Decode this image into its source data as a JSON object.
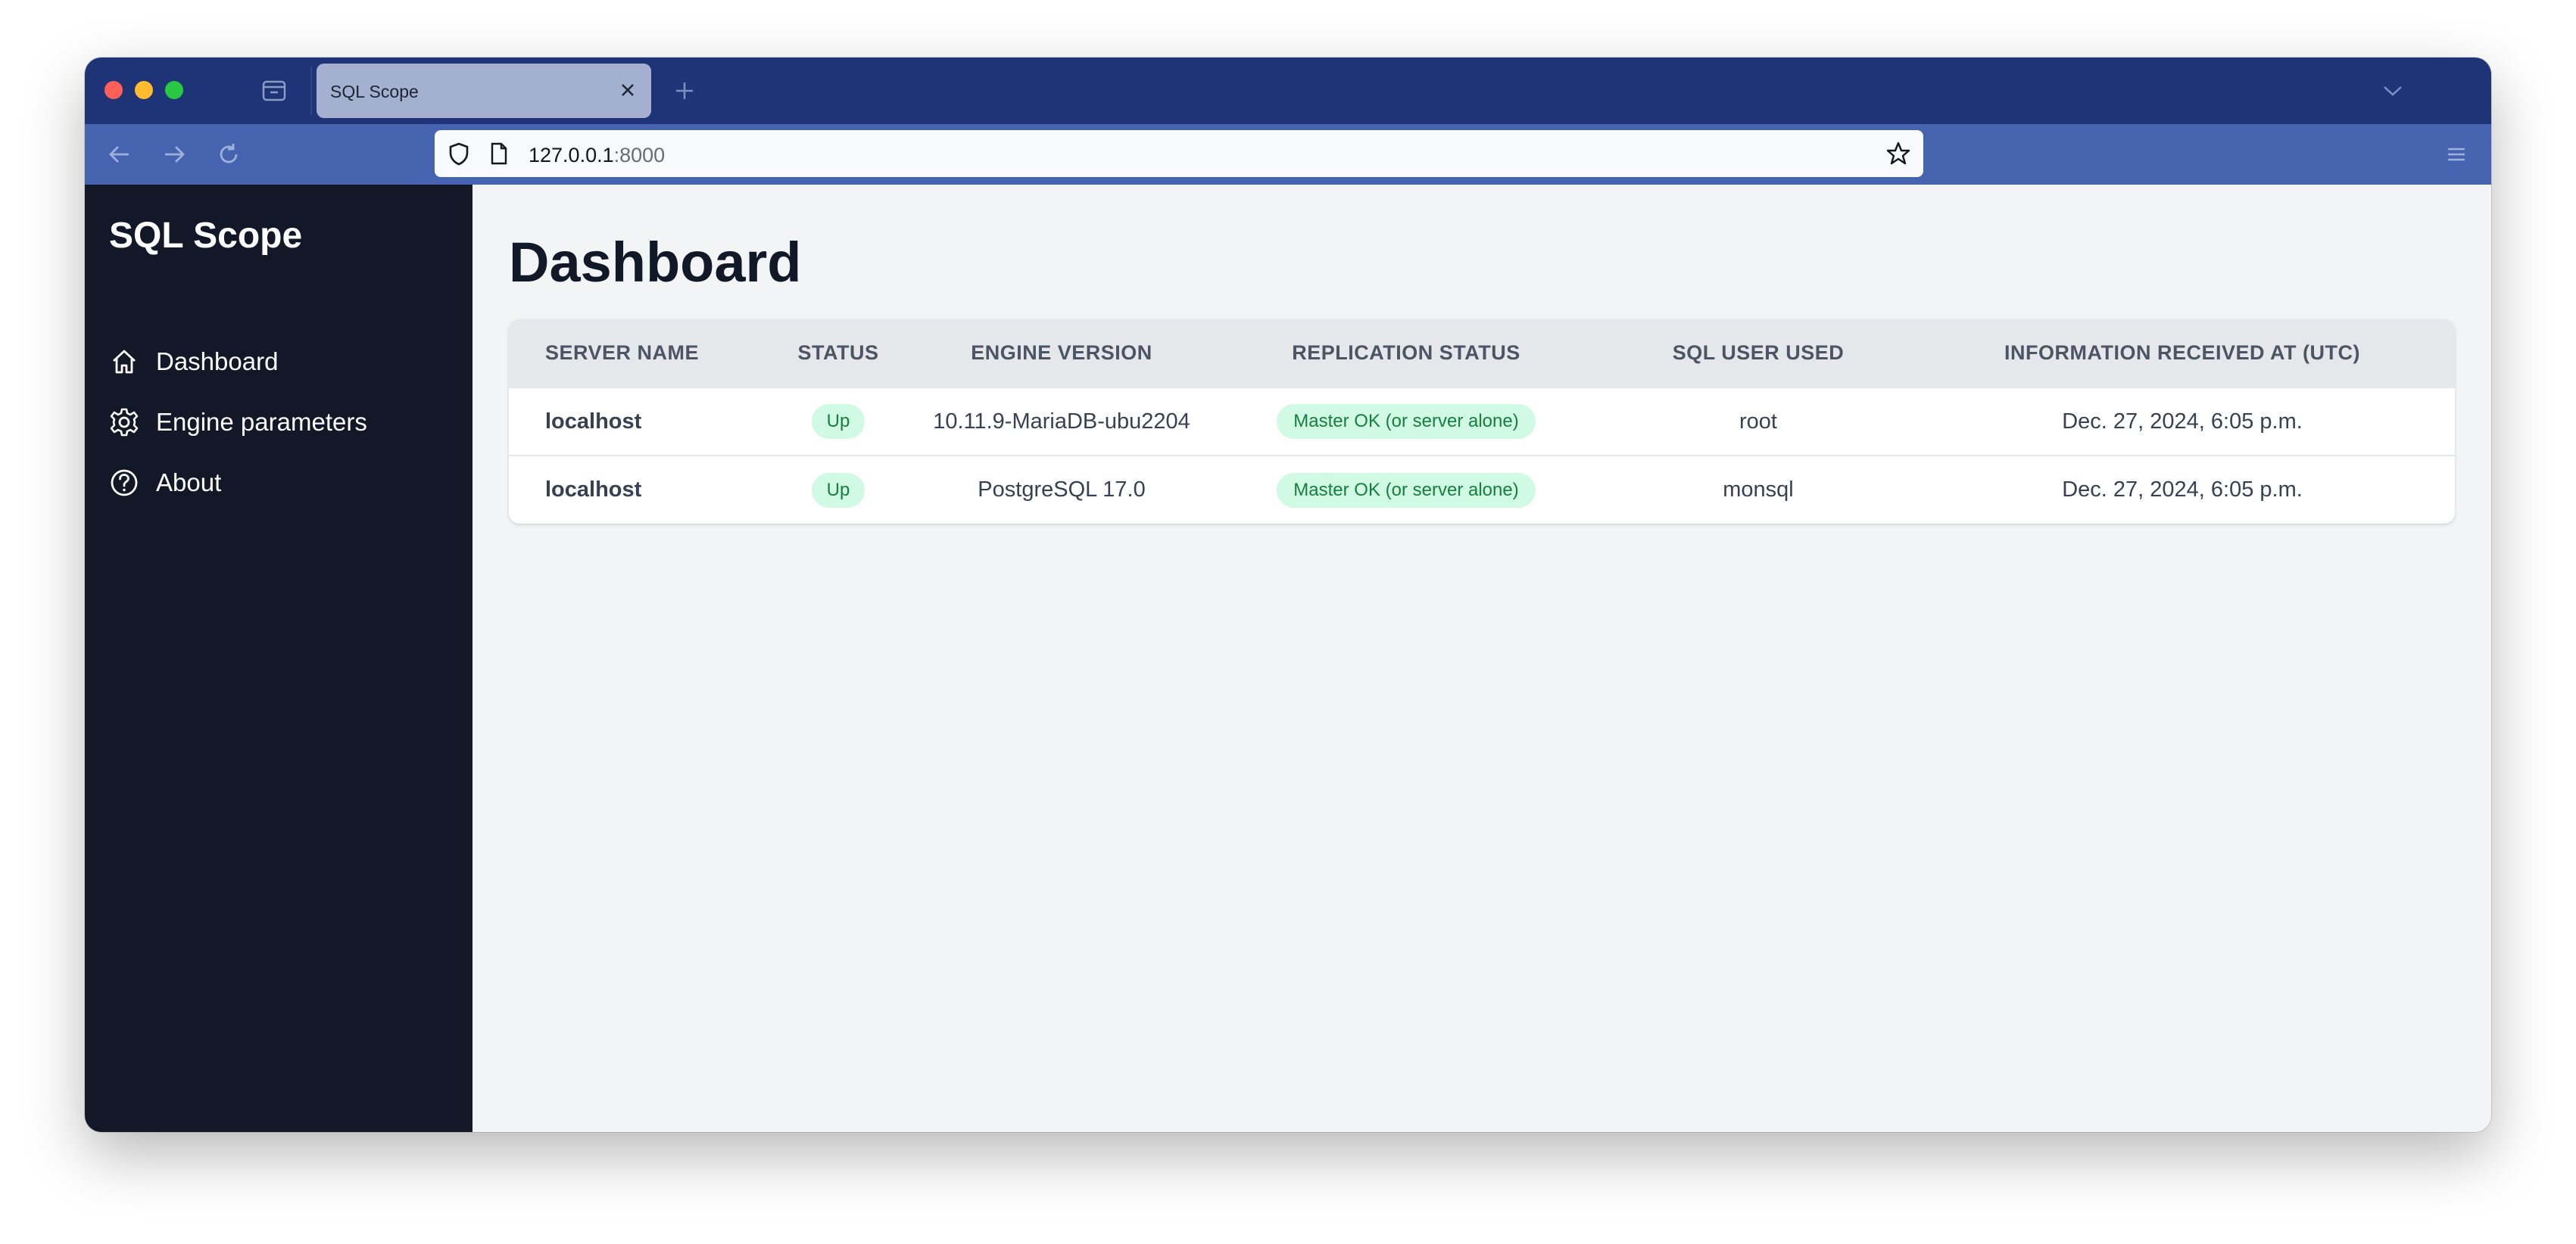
{
  "browser": {
    "tab_title": "SQL Scope",
    "url_host": "127.0.0.1",
    "url_port": ":8000"
  },
  "sidebar": {
    "brand": "SQL Scope",
    "items": [
      {
        "label": "Dashboard",
        "icon": "home-icon"
      },
      {
        "label": "Engine parameters",
        "icon": "gear-icon"
      },
      {
        "label": "About",
        "icon": "question-circle-icon"
      }
    ]
  },
  "main": {
    "title": "Dashboard",
    "table": {
      "headers": [
        "Server name",
        "Status",
        "Engine version",
        "Replication status",
        "SQL user used",
        "Information received at (UTC)"
      ],
      "rows": [
        {
          "server": "localhost",
          "status": "Up",
          "engine": "10.11.9-MariaDB-ubu2204",
          "replication": "Master OK (or server alone)",
          "user": "root",
          "received": "Dec. 27, 2024, 6:05 p.m."
        },
        {
          "server": "localhost",
          "status": "Up",
          "engine": "PostgreSQL 17.0",
          "replication": "Master OK (or server alone)",
          "user": "monsql",
          "received": "Dec. 27, 2024, 6:05 p.m."
        }
      ]
    }
  },
  "colors": {
    "tabbar": "#1e3477",
    "navbar": "#4563ae",
    "sidebar": "#121827",
    "badge_bg": "#d1fae5",
    "badge_text": "#15803d"
  }
}
